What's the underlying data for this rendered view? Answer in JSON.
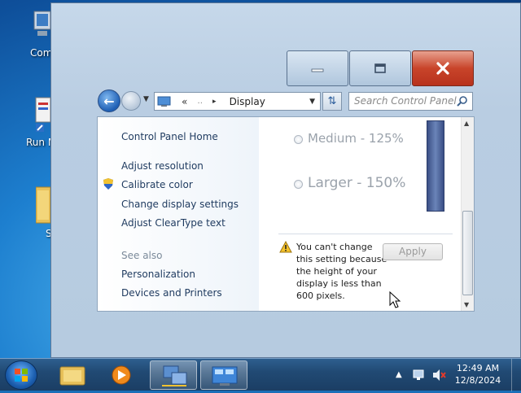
{
  "desktop": {
    "icons": [
      {
        "label": "Com"
      },
      {
        "label": "Run M"
      },
      {
        "label": "S"
      }
    ]
  },
  "toolbar": {
    "address_crumb_overflow": "«",
    "address_crumb_dots": "‥",
    "address_crumb_separator": "▸",
    "address_current": "Display",
    "search_placeholder": "Search Control Panel"
  },
  "sidebar": {
    "items": [
      {
        "label": "Control Panel Home"
      },
      {
        "label": "Adjust resolution"
      },
      {
        "label": "Calibrate color"
      },
      {
        "label": "Change display settings"
      },
      {
        "label": "Adjust ClearType text"
      }
    ],
    "see_also_heading": "See also",
    "see_also": [
      {
        "label": "Personalization"
      },
      {
        "label": "Devices and Printers"
      }
    ]
  },
  "main": {
    "options": [
      {
        "label": "Medium - 125%"
      },
      {
        "label": "Larger - 150%"
      }
    ],
    "warning": "You can't change this setting because the height of your display is less than 600 pixels.",
    "apply_label": "Apply"
  },
  "taskbar": {
    "time": "12:49 AM",
    "date": "12/8/2024"
  },
  "colors": {
    "close_button": "#c8442a",
    "link": "#1e3a5f",
    "taskbar": "#214a74"
  }
}
